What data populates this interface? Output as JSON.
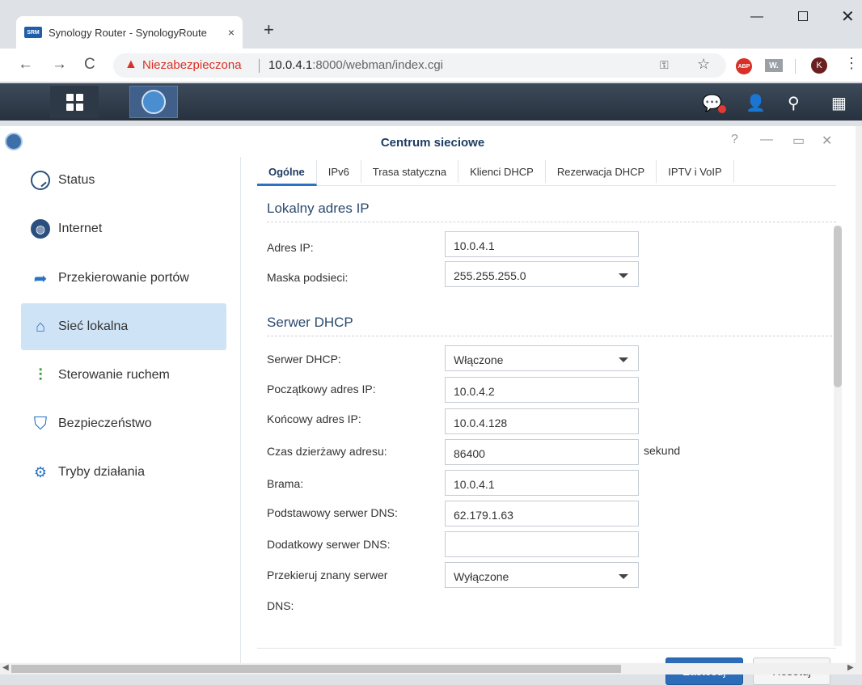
{
  "browser": {
    "tab_title": "Synology Router - SynologyRoute",
    "favicon_text": "SRM",
    "tab_close": "×",
    "new_tab": "+",
    "win_min": "—",
    "win_close": "✕",
    "nav_back": "←",
    "nav_forward": "→",
    "nav_reload": "C",
    "security_warning": "Niezabezpieczona",
    "url_host": "10.0.4.1",
    "url_rest": ":8000/webman/index.cgi",
    "ext_abp": "ABP",
    "ext_wl": "W.",
    "avatar_letter": "K",
    "menu": "⋮"
  },
  "dsm": {
    "icons": [
      "apps-icon",
      "network-center-icon",
      "chat-icon",
      "user-icon",
      "search-icon",
      "widgets-icon"
    ]
  },
  "app": {
    "title": "Centrum sieciowe",
    "controls": {
      "help": "?",
      "minimize": "—",
      "restore": "▭",
      "close": "✕"
    }
  },
  "sidebar": {
    "items": [
      {
        "label": "Status",
        "icon": "status-icon"
      },
      {
        "label": "Internet",
        "icon": "globe-icon"
      },
      {
        "label": "Przekierowanie portów",
        "icon": "arrow-icon"
      },
      {
        "label": "Sieć lokalna",
        "icon": "home-network-icon",
        "active": true
      },
      {
        "label": "Sterowanie ruchem",
        "icon": "traffic-control-icon"
      },
      {
        "label": "Bezpieczeństwo",
        "icon": "shield-icon"
      },
      {
        "label": "Tryby działania",
        "icon": "router-mode-icon"
      }
    ]
  },
  "tabs": [
    {
      "label": "Ogólne",
      "active": true
    },
    {
      "label": "IPv6"
    },
    {
      "label": "Trasa statyczna"
    },
    {
      "label": "Klienci DHCP"
    },
    {
      "label": "Rezerwacja DHCP"
    },
    {
      "label": "IPTV i VoIP"
    }
  ],
  "lan": {
    "section_title": "Lokalny adres IP",
    "ip_label": "Adres IP:",
    "ip_value": "10.0.4.1",
    "mask_label": "Maska podsieci:",
    "mask_value": "255.255.255.0"
  },
  "dhcp": {
    "section_title": "Serwer DHCP",
    "server_label": "Serwer DHCP:",
    "server_value": "Włączone",
    "start_label": "Początkowy adres IP:",
    "start_value": "10.0.4.2",
    "end_label": "Końcowy adres IP:",
    "end_value": "10.0.4.128",
    "lease_label": "Czas dzierżawy adresu:",
    "lease_value": "86400",
    "lease_unit": "sekund",
    "gateway_label": "Brama:",
    "gateway_value": "10.0.4.1",
    "dns1_label": "Podstawowy serwer DNS:",
    "dns1_value": "62.179.1.63",
    "dns2_label": "Dodatkowy serwer DNS:",
    "dns2_value": "",
    "redirect_label_1": "Przekieruj znany serwer",
    "redirect_label_2": "DNS:",
    "redirect_value": "Wyłączone"
  },
  "buttons": {
    "apply": "Zastosuj",
    "reset": "Resetuj"
  },
  "colors": {
    "accent": "#2c6cb8",
    "active_nav": "#cfe3f7",
    "dsm_bar": "#27323f"
  }
}
